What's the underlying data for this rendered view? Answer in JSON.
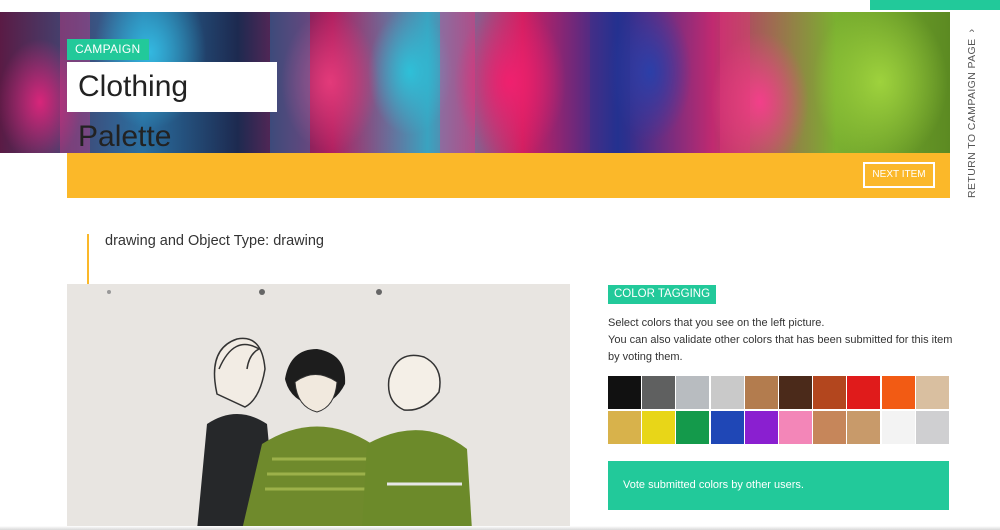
{
  "header": {
    "campaign_label": "CAMPAIGN",
    "title": "Clothing Palette",
    "next_item": "NEXT ITEM",
    "return_link": "RETURN TO CAMPAIGN PAGE"
  },
  "item": {
    "object_type_line": "drawing and Object Type: drawing"
  },
  "color_tagging": {
    "badge": "COLOR TAGGING",
    "desc_line1": "Select colors that you see on the left picture.",
    "desc_line2": "You can also validate other colors that has been submitted for this item by voting them.",
    "swatches": [
      {
        "name": "black",
        "color": "#111111"
      },
      {
        "name": "dark-gray",
        "color": "#5f6060"
      },
      {
        "name": "silver-fabric",
        "color": "#b8bcc0"
      },
      {
        "name": "light-silver",
        "color": "#c9c9c9"
      },
      {
        "name": "tan",
        "color": "#b37c4e"
      },
      {
        "name": "dark-brown",
        "color": "#4b2a1a"
      },
      {
        "name": "rust",
        "color": "#b3461e"
      },
      {
        "name": "red",
        "color": "#e01b1b"
      },
      {
        "name": "orange",
        "color": "#f25b14"
      },
      {
        "name": "beige",
        "color": "#d9bfa0"
      },
      {
        "name": "gold",
        "color": "#d8b24b"
      },
      {
        "name": "yellow",
        "color": "#e8d618"
      },
      {
        "name": "green",
        "color": "#149a4b"
      },
      {
        "name": "blue",
        "color": "#1f47b6"
      },
      {
        "name": "purple",
        "color": "#8a1fd0"
      },
      {
        "name": "pink",
        "color": "#f386b8"
      },
      {
        "name": "multicolor",
        "color": "#c6865a"
      },
      {
        "name": "patterned",
        "color": "#c89a6a"
      },
      {
        "name": "white",
        "color": "#f3f3f3"
      },
      {
        "name": "light-gray",
        "color": "#cfcfd1"
      }
    ],
    "vote_text": "Vote submitted colors by other users."
  },
  "colors": {
    "accent_green": "#22c99a",
    "accent_yellow": "#fbb829"
  }
}
